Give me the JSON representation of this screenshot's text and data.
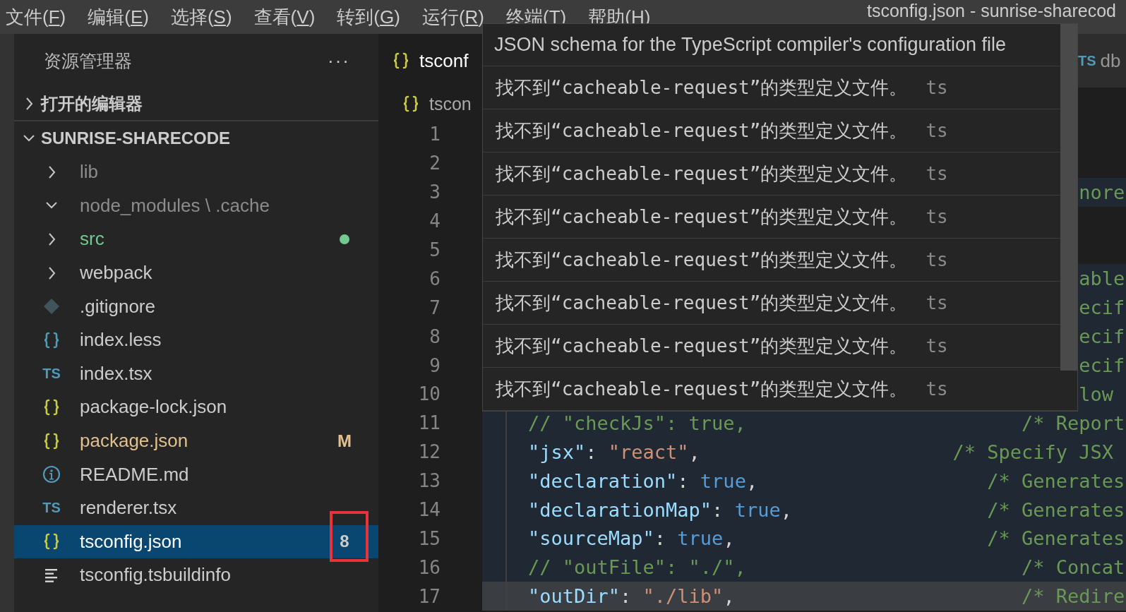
{
  "menu": [
    {
      "label": "文件(F)"
    },
    {
      "label": "编辑(E)"
    },
    {
      "label": "选择(S)"
    },
    {
      "label": "查看(V)"
    },
    {
      "label": "转到(G)"
    },
    {
      "label": "运行(R)"
    },
    {
      "label": "终端(T)"
    },
    {
      "label": "帮助(H)"
    }
  ],
  "window_title": "tsconfig.json - sunrise-sharecod",
  "sidebar": {
    "title": "资源管理器",
    "more": "···",
    "sections": [
      {
        "label": "打开的编辑器",
        "expanded": false
      },
      {
        "label": "SUNRISE-SHARECODE",
        "expanded": true
      }
    ],
    "tree": [
      {
        "kind": "folder",
        "name": "lib",
        "expanded": false,
        "color": "#8c8c8c",
        "dot": false,
        "selected": false
      },
      {
        "kind": "folder",
        "name": "node_modules \\ .cache",
        "expanded": true,
        "color": "#8c8c8c",
        "dot": false,
        "selected": false
      },
      {
        "kind": "folder",
        "name": "src",
        "expanded": false,
        "color": "#73c991",
        "dot": true,
        "selected": false
      },
      {
        "kind": "folder",
        "name": "webpack",
        "expanded": false,
        "color": "#cccccc",
        "dot": false,
        "selected": false
      },
      {
        "kind": "git",
        "name": ".gitignore",
        "color": "#cccccc",
        "selected": false
      },
      {
        "kind": "less",
        "name": "index.less",
        "color": "#cccccc",
        "selected": false
      },
      {
        "kind": "ts",
        "icon_label": "TS",
        "name": "index.tsx",
        "color": "#cccccc",
        "selected": false
      },
      {
        "kind": "json",
        "name": "package-lock.json",
        "color": "#cccccc",
        "selected": false
      },
      {
        "kind": "json",
        "name": "package.json",
        "color": "#e2c08d",
        "badge": "M",
        "selected": false
      },
      {
        "kind": "info",
        "name": "README.md",
        "color": "#cccccc",
        "selected": false
      },
      {
        "kind": "ts",
        "icon_label": "TS",
        "name": "renderer.tsx",
        "color": "#cccccc",
        "selected": false
      },
      {
        "kind": "json",
        "name": "tsconfig.json",
        "color": "#ffffff",
        "badge": "8",
        "annotated": true,
        "selected": true
      },
      {
        "kind": "text",
        "name": "tsconfig.tsbuildinfo",
        "color": "#cccccc",
        "selected": false
      }
    ]
  },
  "editor": {
    "tabs": [
      {
        "label": "tsconf",
        "kind": "json",
        "selected": true
      },
      {
        "label": "db",
        "kind": "ts",
        "icon_label": "TS",
        "selected": false
      }
    ],
    "breadcrumb": {
      "kind": "json",
      "text": "tscon"
    },
    "lines": [
      {
        "number": "1",
        "kind": "covered",
        "shaded": false,
        "current": false
      },
      {
        "number": "2",
        "kind": "covered",
        "shaded": false,
        "current": false
      },
      {
        "number": "3",
        "kind": "covered",
        "fragment": "nore",
        "shaded": true,
        "current": false
      },
      {
        "number": "4",
        "kind": "covered",
        "shaded": false,
        "current": false
      },
      {
        "number": "5",
        "kind": "covered",
        "shaded": false,
        "current": false
      },
      {
        "number": "6",
        "kind": "covered",
        "fragment": "able",
        "shaded": true,
        "current": false
      },
      {
        "number": "7",
        "kind": "covered",
        "fragment": "ecif",
        "shaded": true,
        "current": false
      },
      {
        "number": "8",
        "kind": "covered",
        "fragment": "ecif",
        "shaded": true,
        "current": false
      },
      {
        "number": "9",
        "kind": "covered",
        "fragment": "ecif",
        "shaded": true,
        "current": false
      },
      {
        "number": "10",
        "kind": "covered",
        "fragment": "low",
        "shaded": true,
        "current": false
      },
      {
        "number": "11",
        "kind": "code",
        "tokens": [
          {
            "kind": "comment",
            "text": "// \"checkJs\": true,"
          }
        ],
        "comment": "/* Report",
        "shaded": true,
        "current": false
      },
      {
        "number": "12",
        "kind": "code",
        "tokens": [
          {
            "kind": "key",
            "text": "\"jsx\""
          },
          {
            "kind": "punct",
            "text": ": "
          },
          {
            "kind": "string",
            "text": "\"react\""
          },
          {
            "kind": "punct",
            "text": ","
          }
        ],
        "comment": "/* Specify JSX",
        "shaded": true,
        "current": false
      },
      {
        "number": "13",
        "kind": "code",
        "tokens": [
          {
            "kind": "key",
            "text": "\"declaration\""
          },
          {
            "kind": "punct",
            "text": ": "
          },
          {
            "kind": "bool",
            "text": "true"
          },
          {
            "kind": "punct",
            "text": ","
          }
        ],
        "comment": "/* Generates",
        "shaded": true,
        "current": false
      },
      {
        "number": "14",
        "kind": "code",
        "tokens": [
          {
            "kind": "key",
            "text": "\"declarationMap\""
          },
          {
            "kind": "punct",
            "text": ": "
          },
          {
            "kind": "bool",
            "text": "true"
          },
          {
            "kind": "punct",
            "text": ","
          }
        ],
        "comment": "/* Generates",
        "shaded": true,
        "current": false
      },
      {
        "number": "15",
        "kind": "code",
        "tokens": [
          {
            "kind": "key",
            "text": "\"sourceMap\""
          },
          {
            "kind": "punct",
            "text": ": "
          },
          {
            "kind": "bool",
            "text": "true"
          },
          {
            "kind": "punct",
            "text": ","
          }
        ],
        "comment": "/* Generates",
        "shaded": true,
        "current": false
      },
      {
        "number": "16",
        "kind": "code",
        "tokens": [
          {
            "kind": "comment",
            "text": "// \"outFile\": \"./\","
          }
        ],
        "comment": "/* Concat",
        "shaded": true,
        "current": false
      },
      {
        "number": "17",
        "kind": "code",
        "tokens": [
          {
            "kind": "key",
            "text": "\"outDir\""
          },
          {
            "kind": "punct",
            "text": ": "
          },
          {
            "kind": "string",
            "text": "\"./lib\""
          },
          {
            "kind": "punct",
            "text": ","
          }
        ],
        "comment": "/* Redire",
        "shaded": true,
        "current": true
      }
    ]
  },
  "hover": {
    "title": "JSON schema for the TypeScript compiler's configuration file",
    "items": [
      {
        "message": "找不到“cacheable-request”的类型定义文件。",
        "source": "ts"
      },
      {
        "message": "找不到“cacheable-request”的类型定义文件。",
        "source": "ts"
      },
      {
        "message": "找不到“cacheable-request”的类型定义文件。",
        "source": "ts"
      },
      {
        "message": "找不到“cacheable-request”的类型定义文件。",
        "source": "ts"
      },
      {
        "message": "找不到“cacheable-request”的类型定义文件。",
        "source": "ts"
      },
      {
        "message": "找不到“cacheable-request”的类型定义文件。",
        "source": "ts"
      },
      {
        "message": "找不到“cacheable-request”的类型定义文件。",
        "source": "ts"
      },
      {
        "message": "找不到“cacheable-request”的类型定义文件。",
        "source": "ts"
      }
    ]
  }
}
